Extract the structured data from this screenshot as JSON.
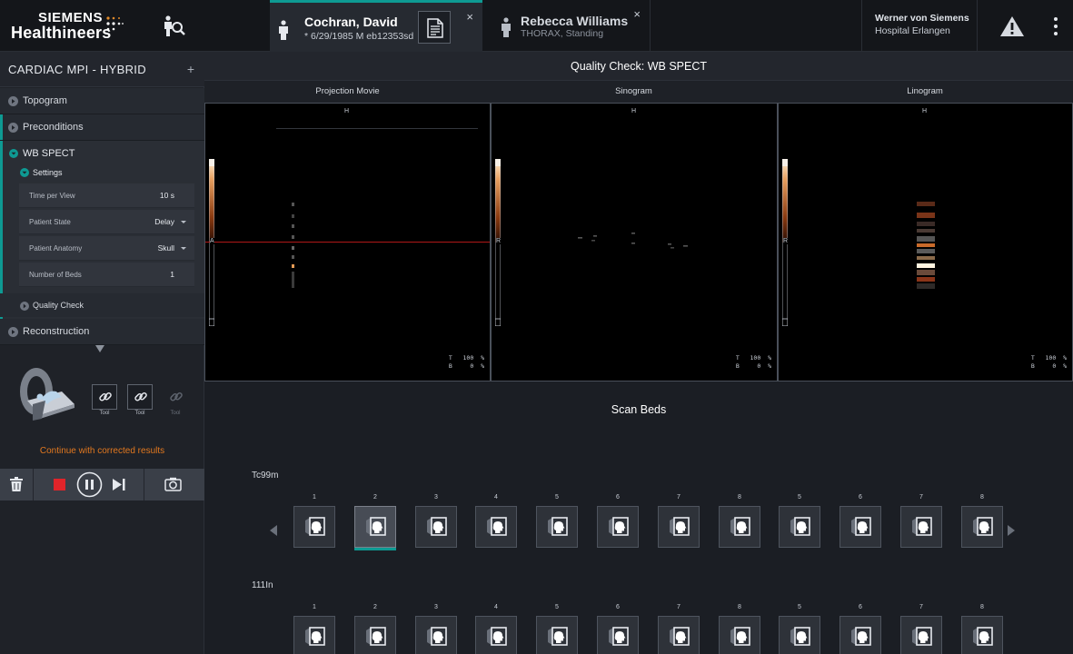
{
  "brand": {
    "line1": "SIEMENS",
    "line2": "Healthineers"
  },
  "tabs": [
    {
      "name": "Cochran, David",
      "sub": "* 6/29/1985  M eb12353sd",
      "close": "×"
    },
    {
      "name": "Rebecca Williams",
      "sub": "THORAX, Standing",
      "close": "×"
    }
  ],
  "hospital": {
    "name": "Werner von Siemens",
    "location": "Hospital Erlangen"
  },
  "workflow": {
    "title": "CARDIAC MPI - HYBRID",
    "add": "+",
    "steps": {
      "topogram": "Topogram",
      "preconditions": "Preconditions",
      "wbspect": "WB SPECT",
      "settings": "Settings",
      "qualitycheck": "Quality Check",
      "reconstruction": "Reconstruction"
    },
    "params": [
      {
        "label": "Time per View",
        "value": "10 s"
      },
      {
        "label": "Patient State",
        "value": "Delay"
      },
      {
        "label": "Patient Anatomy",
        "value": "Skull"
      },
      {
        "label": "Number of Beds",
        "value": "1"
      }
    ],
    "tools": [
      "Tool",
      "Tool",
      "Tool"
    ],
    "continue": "Continue with corrected results"
  },
  "main": {
    "title": "Quality Check: WB SPECT",
    "views": [
      {
        "header": "Projection Movie",
        "orient": "H",
        "side": "A",
        "tb": "T   100  %\nB     0  %"
      },
      {
        "header": "Sinogram",
        "orient": "H",
        "side": "R",
        "tb": "T   100  %\nB     0  %"
      },
      {
        "header": "Linogram",
        "orient": "H",
        "side": "R",
        "tb": "T   100  %\nB     0  %"
      }
    ],
    "scanbeds": {
      "title": "Scan Beds",
      "rows": [
        {
          "label": "Tc99m",
          "beds": [
            "1",
            "2",
            "3",
            "4",
            "5",
            "6",
            "7",
            "8",
            "5",
            "6",
            "7",
            "8"
          ],
          "selected": 1
        },
        {
          "label": "111In",
          "beds": [
            "1",
            "2",
            "3",
            "4",
            "5",
            "6",
            "7",
            "8",
            "5",
            "6",
            "7",
            "8"
          ],
          "selected": -1
        }
      ]
    }
  },
  "colors": {
    "accent": "#0e9a93",
    "warning": "#e2781f"
  }
}
